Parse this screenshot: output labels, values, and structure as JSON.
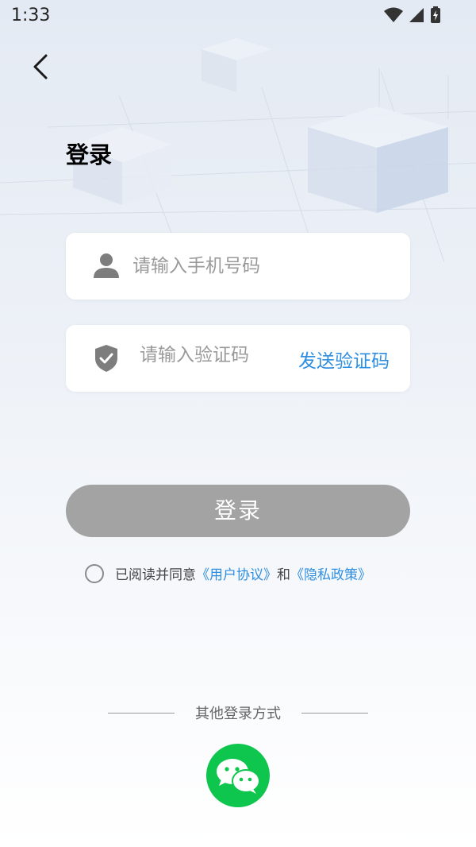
{
  "status_bar": {
    "time": "1:33"
  },
  "page": {
    "title": "登录"
  },
  "phone_field": {
    "placeholder": "请输入手机号码",
    "value": ""
  },
  "code_field": {
    "placeholder": "请输入验证码",
    "value": "",
    "send_label": "发送验证码"
  },
  "login_button": {
    "label": "登录"
  },
  "agreement": {
    "prefix": "已阅读并同意",
    "user_agreement": "《用户协议》",
    "conjunction": "和",
    "privacy_policy": "《隐私政策》",
    "checked": false
  },
  "other_login": {
    "label": "其他登录方式",
    "providers": [
      "wechat"
    ]
  },
  "icons": {
    "back": "chevron-left-icon",
    "user": "user-icon",
    "shield": "shield-check-icon",
    "wechat": "wechat-icon",
    "wifi": "wifi-icon",
    "signal": "signal-icon",
    "battery": "battery-icon"
  },
  "colors": {
    "accent": "#2f8ee0",
    "login_button_disabled": "#a3a3a3",
    "wechat_green": "#0ec54d"
  }
}
